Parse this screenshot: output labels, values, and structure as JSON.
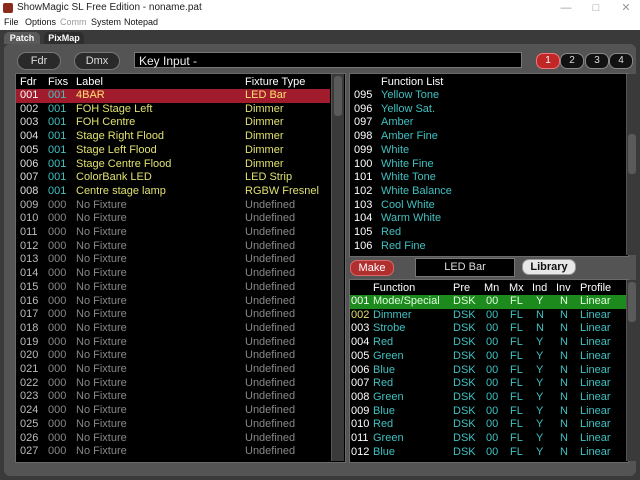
{
  "window": {
    "title": "ShowMagic SL Free Edition  - noname.pat"
  },
  "menu": [
    "File",
    "Options",
    "Comm",
    "System",
    "Notepad"
  ],
  "tabs": [
    "Patch",
    "PixMap"
  ],
  "toolbar": {
    "fdr_label": "Fdr",
    "dmx_label": "Dmx",
    "key_input": "Key Input -",
    "pages": [
      "1",
      "2",
      "3",
      "4"
    ]
  },
  "colors": {
    "selected_row": "#a01c2c",
    "fixture_text": "#e0e070",
    "fix_number": "#40c0c0",
    "empty_text": "#888888",
    "function_text": "#40c0c0",
    "highlight_row": "#1c8a1c"
  },
  "patch": {
    "headers": {
      "fdr": "Fdr",
      "fixs": "Fixs",
      "label": "Label",
      "type": "Fixture Type"
    },
    "rows": [
      {
        "fdr": "001",
        "fixs": "001",
        "label": "4BAR",
        "type": "LED Bar",
        "state": "selected"
      },
      {
        "fdr": "002",
        "fixs": "001",
        "label": "FOH Stage Left",
        "type": "Dimmer",
        "state": "patched"
      },
      {
        "fdr": "003",
        "fixs": "001",
        "label": "FOH Centre",
        "type": "Dimmer",
        "state": "patched"
      },
      {
        "fdr": "004",
        "fixs": "001",
        "label": "Stage Right Flood",
        "type": "Dimmer",
        "state": "patched"
      },
      {
        "fdr": "005",
        "fixs": "001",
        "label": "Stage Left Flood",
        "type": "Dimmer",
        "state": "patched"
      },
      {
        "fdr": "006",
        "fixs": "001",
        "label": "Stage Centre Flood",
        "type": "Dimmer",
        "state": "patched"
      },
      {
        "fdr": "007",
        "fixs": "001",
        "label": "ColorBank LED",
        "type": "LED Strip",
        "state": "patched"
      },
      {
        "fdr": "008",
        "fixs": "001",
        "label": "Centre stage lamp",
        "type": "RGBW Fresnel",
        "state": "patched"
      },
      {
        "fdr": "009",
        "fixs": "000",
        "label": "No Fixture",
        "type": "Undefined",
        "state": "empty"
      },
      {
        "fdr": "010",
        "fixs": "000",
        "label": "No Fixture",
        "type": "Undefined",
        "state": "empty"
      },
      {
        "fdr": "011",
        "fixs": "000",
        "label": "No Fixture",
        "type": "Undefined",
        "state": "empty"
      },
      {
        "fdr": "012",
        "fixs": "000",
        "label": "No Fixture",
        "type": "Undefined",
        "state": "empty"
      },
      {
        "fdr": "013",
        "fixs": "000",
        "label": "No Fixture",
        "type": "Undefined",
        "state": "empty"
      },
      {
        "fdr": "014",
        "fixs": "000",
        "label": "No Fixture",
        "type": "Undefined",
        "state": "empty"
      },
      {
        "fdr": "015",
        "fixs": "000",
        "label": "No Fixture",
        "type": "Undefined",
        "state": "empty"
      },
      {
        "fdr": "016",
        "fixs": "000",
        "label": "No Fixture",
        "type": "Undefined",
        "state": "empty"
      },
      {
        "fdr": "017",
        "fixs": "000",
        "label": "No Fixture",
        "type": "Undefined",
        "state": "empty"
      },
      {
        "fdr": "018",
        "fixs": "000",
        "label": "No Fixture",
        "type": "Undefined",
        "state": "empty"
      },
      {
        "fdr": "019",
        "fixs": "000",
        "label": "No Fixture",
        "type": "Undefined",
        "state": "empty"
      },
      {
        "fdr": "020",
        "fixs": "000",
        "label": "No Fixture",
        "type": "Undefined",
        "state": "empty"
      },
      {
        "fdr": "021",
        "fixs": "000",
        "label": "No Fixture",
        "type": "Undefined",
        "state": "empty"
      },
      {
        "fdr": "022",
        "fixs": "000",
        "label": "No Fixture",
        "type": "Undefined",
        "state": "empty"
      },
      {
        "fdr": "023",
        "fixs": "000",
        "label": "No Fixture",
        "type": "Undefined",
        "state": "empty"
      },
      {
        "fdr": "024",
        "fixs": "000",
        "label": "No Fixture",
        "type": "Undefined",
        "state": "empty"
      },
      {
        "fdr": "025",
        "fixs": "000",
        "label": "No Fixture",
        "type": "Undefined",
        "state": "empty"
      },
      {
        "fdr": "026",
        "fixs": "000",
        "label": "No Fixture",
        "type": "Undefined",
        "state": "empty"
      },
      {
        "fdr": "027",
        "fixs": "000",
        "label": "No Fixture",
        "type": "Undefined",
        "state": "empty"
      }
    ]
  },
  "function_list": {
    "header": "Function List",
    "items": [
      {
        "num": "095",
        "name": "Yellow Tone"
      },
      {
        "num": "096",
        "name": "Yellow Sat."
      },
      {
        "num": "097",
        "name": "Amber"
      },
      {
        "num": "098",
        "name": "Amber Fine"
      },
      {
        "num": "099",
        "name": "White"
      },
      {
        "num": "100",
        "name": "White Fine"
      },
      {
        "num": "101",
        "name": "White Tone"
      },
      {
        "num": "102",
        "name": "White Balance"
      },
      {
        "num": "103",
        "name": "Cool White"
      },
      {
        "num": "104",
        "name": "Warm White"
      },
      {
        "num": "105",
        "name": "Red"
      },
      {
        "num": "106",
        "name": "Red Fine"
      }
    ]
  },
  "fixture_controls": {
    "make_label": "Make",
    "fixture_name": "LED Bar",
    "library_label": "Library"
  },
  "profile": {
    "headers": {
      "num": "",
      "function": "Function",
      "pre": "Pre",
      "mn": "Mn",
      "mx": "Mx",
      "ind": "Ind",
      "inv": "Inv",
      "profile": "Profile"
    },
    "rows": [
      {
        "num": "001",
        "function": "Mode/Special",
        "pre": "DSK",
        "mn": "00",
        "mx": "FL",
        "ind": "Y",
        "inv": "N",
        "profile": "Linear",
        "state": "highlight"
      },
      {
        "num": "002",
        "function": "Dimmer",
        "pre": "DSK",
        "mn": "00",
        "mx": "FL",
        "ind": "N",
        "inv": "N",
        "profile": "Linear",
        "state": "alt"
      },
      {
        "num": "003",
        "function": "Strobe",
        "pre": "DSK",
        "mn": "00",
        "mx": "FL",
        "ind": "N",
        "inv": "N",
        "profile": "Linear",
        "state": "normal"
      },
      {
        "num": "004",
        "function": "Red",
        "pre": "DSK",
        "mn": "00",
        "mx": "FL",
        "ind": "Y",
        "inv": "N",
        "profile": "Linear",
        "state": "normal"
      },
      {
        "num": "005",
        "function": "Green",
        "pre": "DSK",
        "mn": "00",
        "mx": "FL",
        "ind": "Y",
        "inv": "N",
        "profile": "Linear",
        "state": "normal"
      },
      {
        "num": "006",
        "function": "Blue",
        "pre": "DSK",
        "mn": "00",
        "mx": "FL",
        "ind": "Y",
        "inv": "N",
        "profile": "Linear",
        "state": "normal"
      },
      {
        "num": "007",
        "function": "Red",
        "pre": "DSK",
        "mn": "00",
        "mx": "FL",
        "ind": "Y",
        "inv": "N",
        "profile": "Linear",
        "state": "normal"
      },
      {
        "num": "008",
        "function": "Green",
        "pre": "DSK",
        "mn": "00",
        "mx": "FL",
        "ind": "Y",
        "inv": "N",
        "profile": "Linear",
        "state": "normal"
      },
      {
        "num": "009",
        "function": "Blue",
        "pre": "DSK",
        "mn": "00",
        "mx": "FL",
        "ind": "Y",
        "inv": "N",
        "profile": "Linear",
        "state": "normal"
      },
      {
        "num": "010",
        "function": "Red",
        "pre": "DSK",
        "mn": "00",
        "mx": "FL",
        "ind": "Y",
        "inv": "N",
        "profile": "Linear",
        "state": "normal"
      },
      {
        "num": "011",
        "function": "Green",
        "pre": "DSK",
        "mn": "00",
        "mx": "FL",
        "ind": "Y",
        "inv": "N",
        "profile": "Linear",
        "state": "normal"
      },
      {
        "num": "012",
        "function": "Blue",
        "pre": "DSK",
        "mn": "00",
        "mx": "FL",
        "ind": "Y",
        "inv": "N",
        "profile": "Linear",
        "state": "normal"
      }
    ]
  }
}
